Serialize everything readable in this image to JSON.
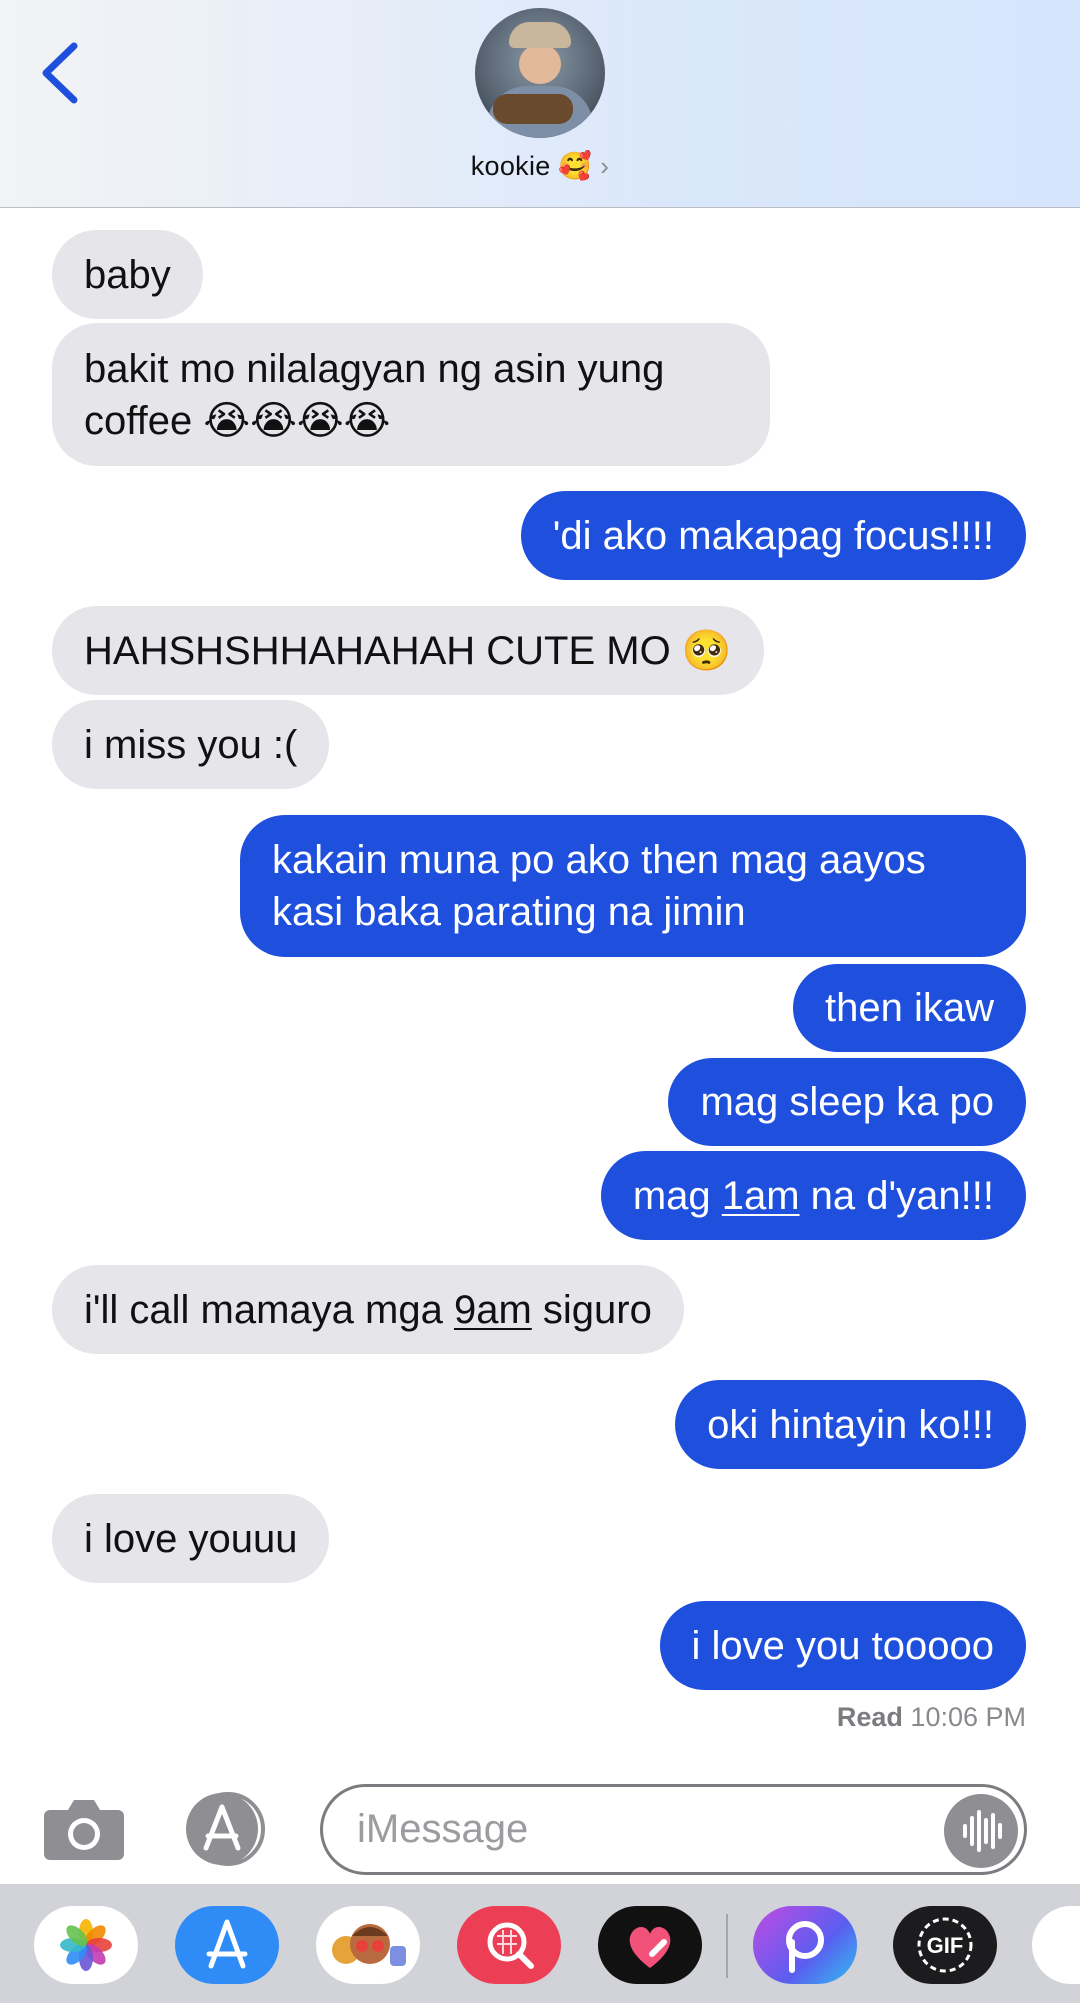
{
  "header": {
    "contact_name": "kookie 🥰",
    "chevron": "›"
  },
  "messages": [
    {
      "side": "in",
      "text": "baby"
    },
    {
      "side": "in",
      "lines": [
        "bakit mo nilalagyan ng asin yung",
        "coffee 😭😭😭😭"
      ]
    },
    {
      "side": "out",
      "text": "'di ako makapag focus!!!!"
    },
    {
      "side": "in",
      "text": "HAHSHSHHAHAHAH CUTE MO 🥺"
    },
    {
      "side": "in",
      "text": "i miss you :("
    },
    {
      "side": "out",
      "lines": [
        "kakain muna po ako then mag aayos",
        "kasi baka parating na jimin"
      ]
    },
    {
      "side": "out",
      "text": "then ikaw"
    },
    {
      "side": "out",
      "text": "mag sleep ka po"
    },
    {
      "side": "out",
      "pre": "mag ",
      "link": "1am",
      "post": " na d'yan!!!"
    },
    {
      "side": "in",
      "pre": "i'll call mamaya mga ",
      "link": "9am",
      "post": " siguro"
    },
    {
      "side": "out",
      "text": "oki hintayin ko!!!"
    },
    {
      "side": "in",
      "text": "i love youuu"
    },
    {
      "side": "out",
      "text": "i love you tooooo"
    }
  ],
  "receipt": {
    "label": "Read",
    "time": "10:06 PM"
  },
  "composer": {
    "placeholder": "iMessage"
  },
  "icons": {
    "back": "chevron-left-icon",
    "camera": "camera-icon",
    "app_store": "app-store-icon",
    "audio": "waveform-icon"
  },
  "drawer_apps": [
    {
      "name": "Photos",
      "color": "#ffffff"
    },
    {
      "name": "App Store",
      "color": "#2f8cf6"
    },
    {
      "name": "Memoji",
      "color": "#ffffff"
    },
    {
      "name": "Search Images",
      "color": "#ec3f55"
    },
    {
      "name": "Digital Touch",
      "color": "#111111"
    },
    {
      "name": "PicsArt",
      "color": "#8f4ee6"
    },
    {
      "name": "GIF",
      "color": "#1c1c1e"
    }
  ],
  "colors": {
    "outgoing": "#1f4fdd",
    "incoming": "#e5e5ea",
    "accent": "#1f4fdd"
  }
}
